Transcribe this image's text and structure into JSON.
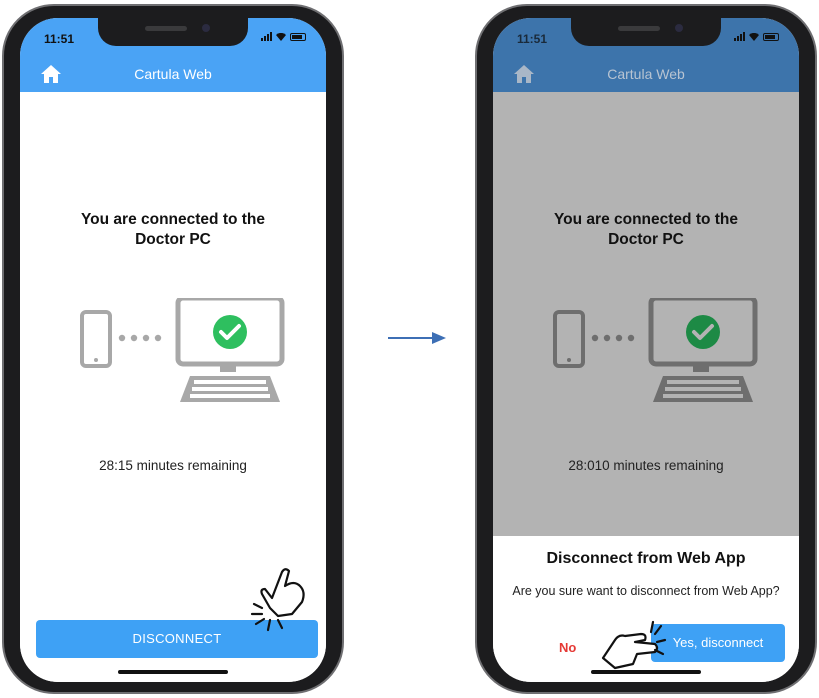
{
  "colors": {
    "header": "#4aa3f5",
    "header_dim": "#3d74ab",
    "button": "#3ea1f5",
    "check": "#2ebf5f",
    "no": "#e53935"
  },
  "left_screen": {
    "status_time": "11:51",
    "app_title": "Cartula Web",
    "connect_line1": "You are connected to the",
    "connect_line2": "Doctor PC",
    "remaining": "28:15 minutes remaining",
    "disconnect_label": "DISCONNECT"
  },
  "right_screen": {
    "status_time": "11:51",
    "app_title": "Cartula Web",
    "connect_line1": "You are connected to the",
    "connect_line2": "Doctor PC",
    "remaining": "28:010 minutes remaining",
    "dialog": {
      "title": "Disconnect from Web App",
      "message": "Are you sure want to disconnect from Web App?",
      "no_label": "No",
      "yes_label": "Yes, disconnect"
    }
  },
  "icons": [
    "home-icon",
    "phone-icon",
    "computer-icon",
    "check-icon",
    "arrow-right-icon",
    "tap-hand-icon",
    "signal-icon",
    "wifi-icon",
    "battery-icon"
  ]
}
